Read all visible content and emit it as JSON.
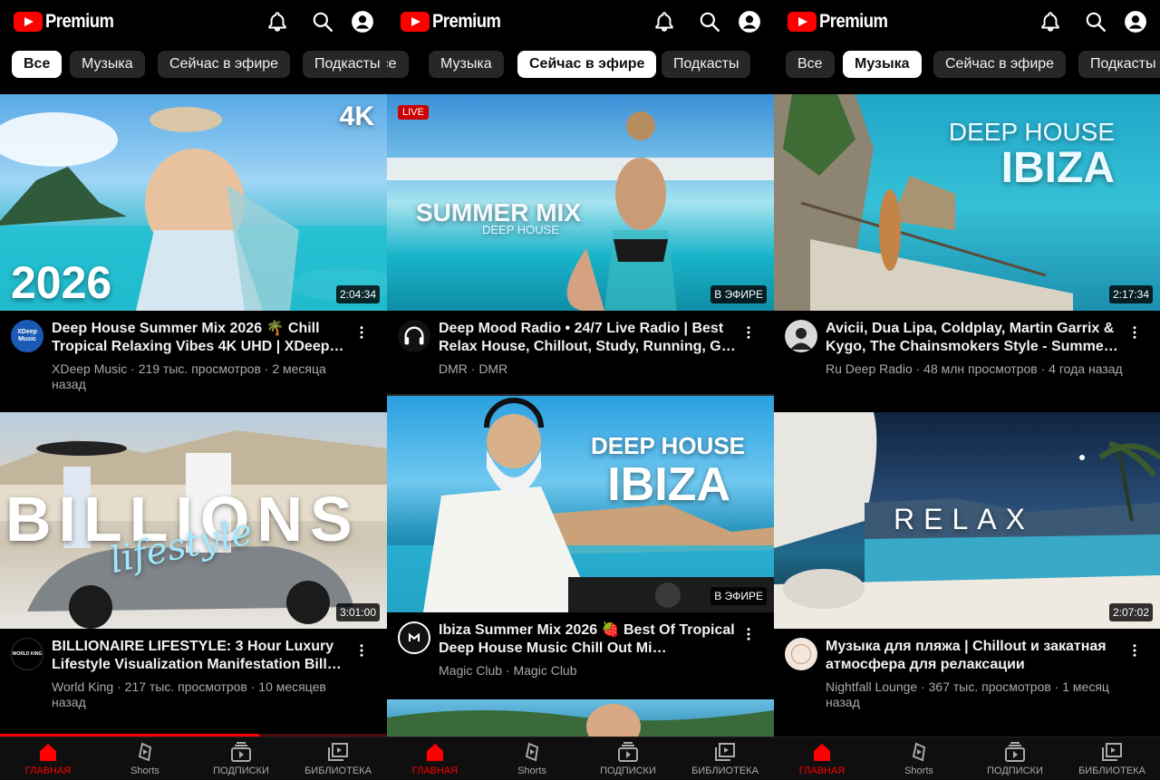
{
  "app": {
    "logo_text": "Premium"
  },
  "accent": "#ff0000",
  "panels": [
    {
      "chips": [
        "Все",
        "Музыка",
        "Сейчас в эфире",
        "Подкасты"
      ],
      "active_chip": 0,
      "videos": [
        {
          "caption_top": "4K",
          "caption_bottom": "2026",
          "title": "Deep House Summer Mix 2026 🌴 Chill Tropical Relaxing Vibes 4K UHD | XDeep…",
          "meta": "XDeep Music · 219 тыс. просмотров · 2 месяца назад",
          "duration": "2:04:34",
          "channel_avatar_text": "XDeep Music",
          "thumb_icon": "beach-woman-thumbnail"
        },
        {
          "caption_top": "BILLIONS",
          "caption_bottom": "lifestyle",
          "title": "BILLIONAIRE LIFESTYLE: 3 Hour Luxury Lifestyle Visualization Manifestation Bill…",
          "meta": "World King · 217 тыс. просмотров · 10 месяцев назад",
          "duration": "3:01:00",
          "channel_avatar_text": "WORLD KING",
          "thumb_icon": "luxury-car-thumbnail"
        }
      ],
      "progress": 0.67,
      "nav": [
        "ГЛАВНАЯ",
        "Shorts",
        "ПОДПИСКИ",
        "БИБЛИОТЕКА"
      ],
      "active_nav": 0
    },
    {
      "chips": [
        "Все",
        "Музыка",
        "Сейчас в эфире",
        "Подкасты"
      ],
      "active_chip": 2,
      "videos": [
        {
          "caption_top": "SUMMER MIX",
          "caption_bottom": "DEEP HOUSE",
          "title": "Deep Mood Radio • 24/7 Live Radio | Best Relax House, Chillout, Study, Running, G…",
          "meta": "DMR · DMR",
          "badge": "В ЭФИРЕ",
          "live_label": "LIVE",
          "thumb_icon": "sea-woman-thumbnail"
        },
        {
          "caption_top": "DEEP HOUSE",
          "caption_bottom": "IBIZA",
          "title": "Ibiza Summer Mix 2026 🍓 Best Of Tropical Deep House Music Chill Out Mi…",
          "meta": "Magic Club · Magic Club",
          "badge": "В ЭФИРЕ",
          "thumb_icon": "dj-thumbnail"
        }
      ],
      "nav": [
        "ГЛАВНАЯ",
        "Shorts",
        "ПОДПИСКИ",
        "БИБЛИОТЕКА"
      ],
      "active_nav": 0
    },
    {
      "chips": [
        "Все",
        "Музыка",
        "Сейчас в эфире",
        "Подкасты"
      ],
      "active_chip": 1,
      "videos": [
        {
          "caption_top": "DEEP HOUSE",
          "caption_bottom": "IBIZA",
          "title": "Avicii, Dua Lipa, Coldplay, Martin Garrix & Kygo, The Chainsmokers Style - Summe…",
          "meta": "Ru Deep Radio · 48 млн просмотров · 4 года назад",
          "duration": "2:17:34",
          "thumb_icon": "cliff-woman-thumbnail"
        },
        {
          "caption_top": "RELAX",
          "title": "Музыка для пляжа | Chillout и закатная атмосфера для релаксации",
          "meta": "Nightfall Lounge · 367 тыс. просмотров · 1 месяц назад",
          "duration": "2:07:02",
          "thumb_icon": "night-pool-thumbnail"
        }
      ],
      "nav": [
        "ГЛАВНАЯ",
        "Shorts",
        "ПОДПИСКИ",
        "БИБЛИОТЕКА"
      ],
      "active_nav": 0
    }
  ]
}
